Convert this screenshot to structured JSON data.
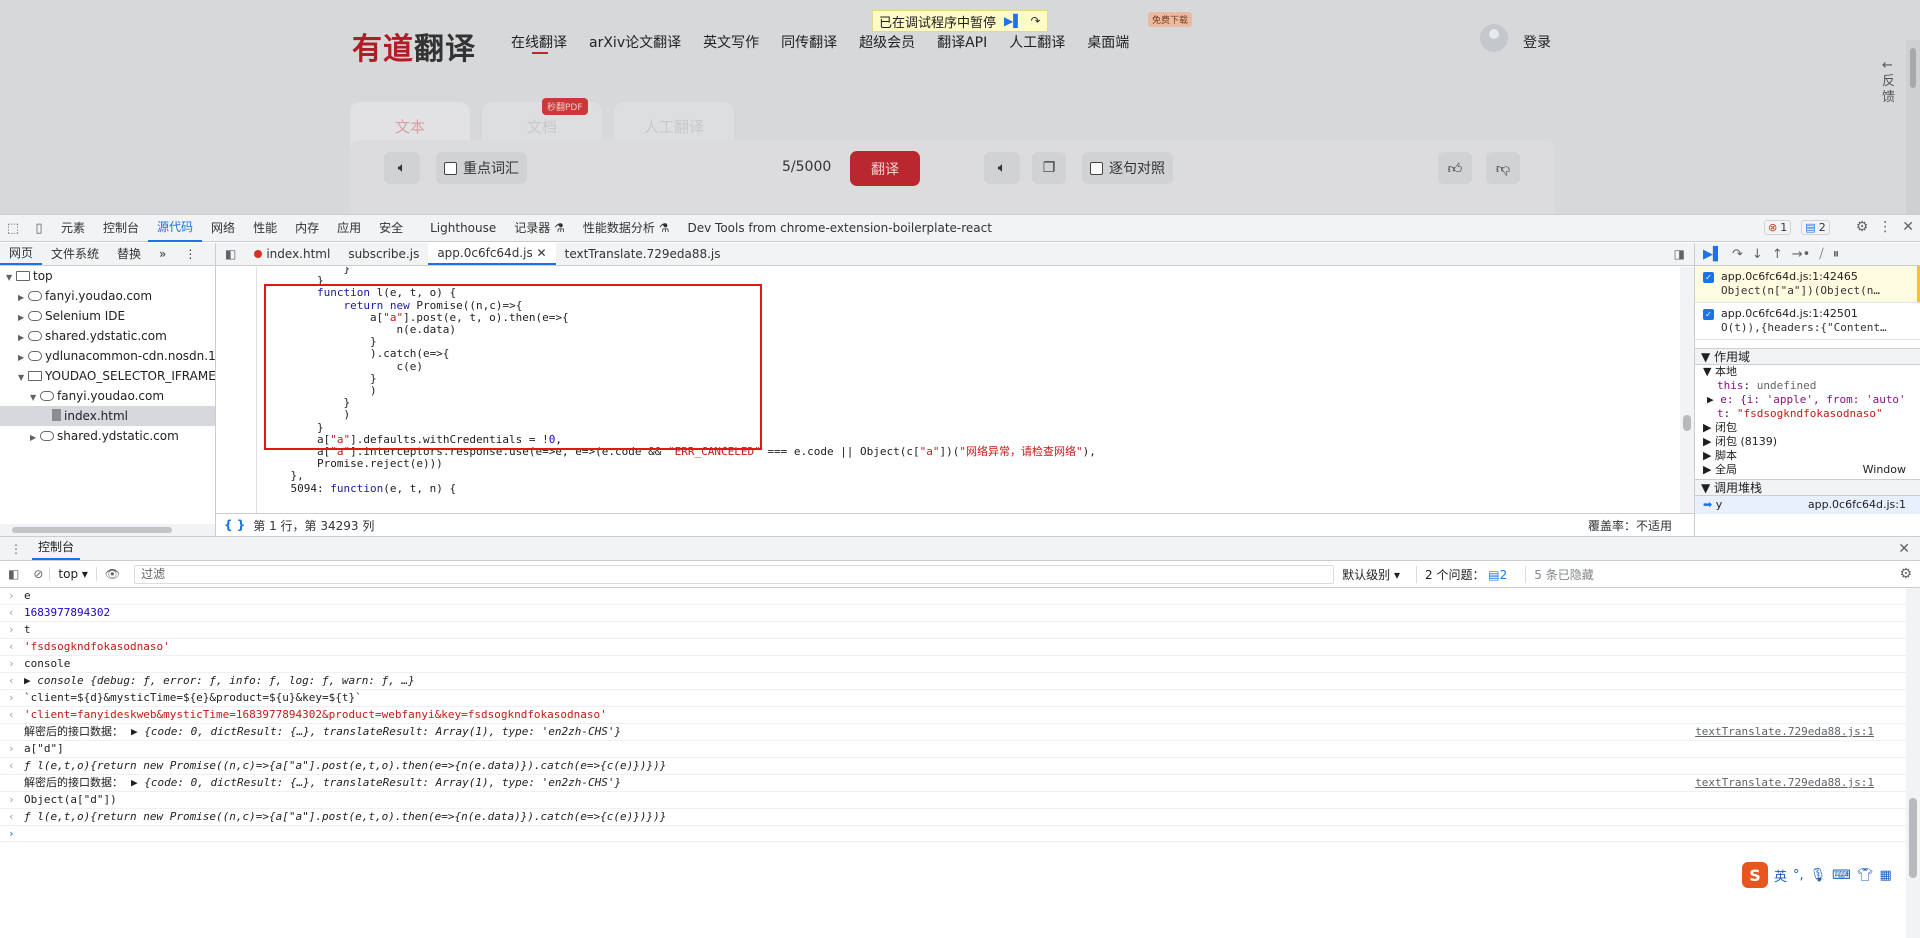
{
  "website": {
    "pause_banner": "已在调试程序中暂停",
    "logo_main": "有道",
    "logo_sub": "翻译",
    "nav": [
      "在线翻译",
      "arXiv论文翻译",
      "英文写作",
      "同传翻译",
      "超级会员",
      "翻译API",
      "人工翻译",
      "桌面端"
    ],
    "free_badge": "免费下载",
    "login": "登录",
    "feedback": "反馈",
    "doc_tabs": [
      "文本",
      "文档",
      "人工翻译"
    ],
    "pdf_badge": "秒翻PDF",
    "key_vocab": "重点词汇",
    "char_count": "5/5000",
    "translate_btn": "翻译",
    "sentence_compare": "逐句对照"
  },
  "devtools": {
    "tabs": [
      "元素",
      "控制台",
      "源代码",
      "网络",
      "性能",
      "内存",
      "应用",
      "安全",
      "Lighthouse",
      "记录器",
      "性能数据分析",
      "Dev Tools from chrome-extension-boilerplate-react"
    ],
    "active_tab": "源代码",
    "error_count": "1",
    "message_count": "2",
    "navigator": {
      "tabs": [
        "网页",
        "文件系统",
        "替换"
      ],
      "tree": [
        {
          "label": "top",
          "depth": 0,
          "icon": "box",
          "arrow": "▼"
        },
        {
          "label": "fanyi.youdao.com",
          "depth": 1,
          "icon": "cloud",
          "arrow": "▶"
        },
        {
          "label": "Selenium IDE",
          "depth": 1,
          "icon": "cloud",
          "arrow": "▶"
        },
        {
          "label": "shared.ydstatic.com",
          "depth": 1,
          "icon": "cloud",
          "arrow": "▶"
        },
        {
          "label": "ydlunacommon-cdn.nosdn.127.",
          "depth": 1,
          "icon": "cloud",
          "arrow": "▶"
        },
        {
          "label": "YOUDAO_SELECTOR_IFRAME (in",
          "depth": 1,
          "icon": "box",
          "arrow": "▼"
        },
        {
          "label": "fanyi.youdao.com",
          "depth": 2,
          "icon": "cloud",
          "arrow": "▼"
        },
        {
          "label": "index.html",
          "depth": 3,
          "icon": "file",
          "arrow": ""
        },
        {
          "label": "shared.ydstatic.com",
          "depth": 2,
          "icon": "cloud",
          "arrow": "▶"
        }
      ]
    },
    "file_tabs": [
      "index.html",
      "subscribe.js",
      "app.0c6fc64d.js",
      "textTranslate.729eda88.js"
    ],
    "active_file": "app.0c6fc64d.js",
    "status_position": "第 1 行，第 34293 列",
    "coverage": "覆盖率：不适用",
    "breakpoints": [
      {
        "file": "app.0c6fc64d.js:1:42465",
        "code": "Object(n[\"a\"])(Object(n…"
      },
      {
        "file": "app.0c6fc64d.js:1:42501",
        "code": "O(t)),{headers:{\"Content…"
      }
    ],
    "scope_header": "作用域",
    "scope_local": "本地",
    "scope_this": "this",
    "scope_this_val": "undefined",
    "scope_e": "e: {i: 'apple', from: 'auto'",
    "scope_t": "t",
    "scope_t_val": "\"fsdsogkndfokasodnaso\"",
    "scope_closure": "闭包",
    "scope_closure2": "闭包 (8139)",
    "scope_script": "脚本",
    "scope_global": "全局",
    "scope_global_val": "Window",
    "callstack_header": "调用堆栈",
    "callstack_fn": "y",
    "callstack_loc": "app.0c6fc64d.js:1",
    "console_tab": "控制台",
    "context": "top",
    "filter_placeholder": "过滤",
    "level": "默认级别",
    "issues": "2 个问题：",
    "issues_count": "2",
    "hidden": "5 条已隐藏",
    "console_lines": [
      {
        "kind": "in",
        "text": "e"
      },
      {
        "kind": "out",
        "text": "1683977894302",
        "cls": "num"
      },
      {
        "kind": "in",
        "text": "t"
      },
      {
        "kind": "out",
        "text": "'fsdsogkndfokasodnaso'",
        "cls": "str"
      },
      {
        "kind": "in",
        "text": "console"
      },
      {
        "kind": "out",
        "text": "▶ console {debug: ƒ, error: ƒ, info: ƒ, log: ƒ, warn: ƒ, …}",
        "cls": "it"
      },
      {
        "kind": "in",
        "text": "`client=${d}&mysticTime=${e}&product=${u}&key=${t}`"
      },
      {
        "kind": "out",
        "text": "'client=fanyideskweb&mysticTime=1683977894302&product=webfanyi&key=fsdsogkndfokasodnaso'",
        "cls": "str"
      },
      {
        "kind": "info",
        "label": "解密后的接口数据：",
        "text": "▶ {code: 0, dictResult: {…}, translateResult: Array(1), type: 'en2zh-CHS'}",
        "src": "textTranslate.729eda88.js:1"
      },
      {
        "kind": "in",
        "text": "a[\"d\"]"
      },
      {
        "kind": "out",
        "text": "ƒ l(e,t,o){return new Promise((n,c)=>{a[\"a\"].post(e,t,o).then(e=>{n(e.data)}).catch(e=>{c(e)})})}",
        "cls": "it"
      },
      {
        "kind": "info",
        "label": "解密后的接口数据：",
        "text": "▶ {code: 0, dictResult: {…}, translateResult: Array(1), type: 'en2zh-CHS'}",
        "src": "textTranslate.729eda88.js:1"
      },
      {
        "kind": "in",
        "text": "Object(a[\"d\"])"
      },
      {
        "kind": "out",
        "text": "ƒ l(e,t,o){return new Promise((n,c)=>{a[\"a\"].post(e,t,o).then(e=>{n(e.data)}).catch(e=>{c(e)})})}",
        "cls": "it"
      },
      {
        "kind": "prompt",
        "text": ""
      }
    ]
  },
  "code_lines": [
    {
      "text": "            }",
      "cls": ""
    },
    {
      "text": "        }",
      "cls": ""
    },
    {
      "text": "        function l(e, t, o) {",
      "cls": "fn"
    },
    {
      "text": "            return new Promise((n,c)=>{",
      "cls": "ret"
    },
    {
      "text": "                a[\"a\"].post(e, t, o).then(e=>{",
      "cls": ""
    },
    {
      "text": "                    n(e.data)",
      "cls": ""
    },
    {
      "text": "                }",
      "cls": ""
    },
    {
      "text": "                ).catch(e=>{",
      "cls": ""
    },
    {
      "text": "                    c(e)",
      "cls": ""
    },
    {
      "text": "                }",
      "cls": ""
    },
    {
      "text": "                )",
      "cls": ""
    },
    {
      "text": "            }",
      "cls": ""
    },
    {
      "text": "            )",
      "cls": ""
    },
    {
      "text": "        }",
      "cls": ""
    },
    {
      "text": "        a[\"a\"].defaults.withCredentials = !0,",
      "cls": ""
    },
    {
      "text": "        a[\"a\"].interceptors.response.use(e=>e, e=>(e.code && \"ERR_CANCELED\" === e.code || Object(c[\"a\"])(\"网络异常，请检查网络\"),",
      "cls": ""
    },
    {
      "text": "        Promise.reject(e)))",
      "cls": ""
    },
    {
      "text": "    },",
      "cls": ""
    },
    {
      "text": "    5094: function(e, t, n) {",
      "cls": ""
    }
  ],
  "ime": {
    "logo": "S",
    "lang": "英"
  }
}
